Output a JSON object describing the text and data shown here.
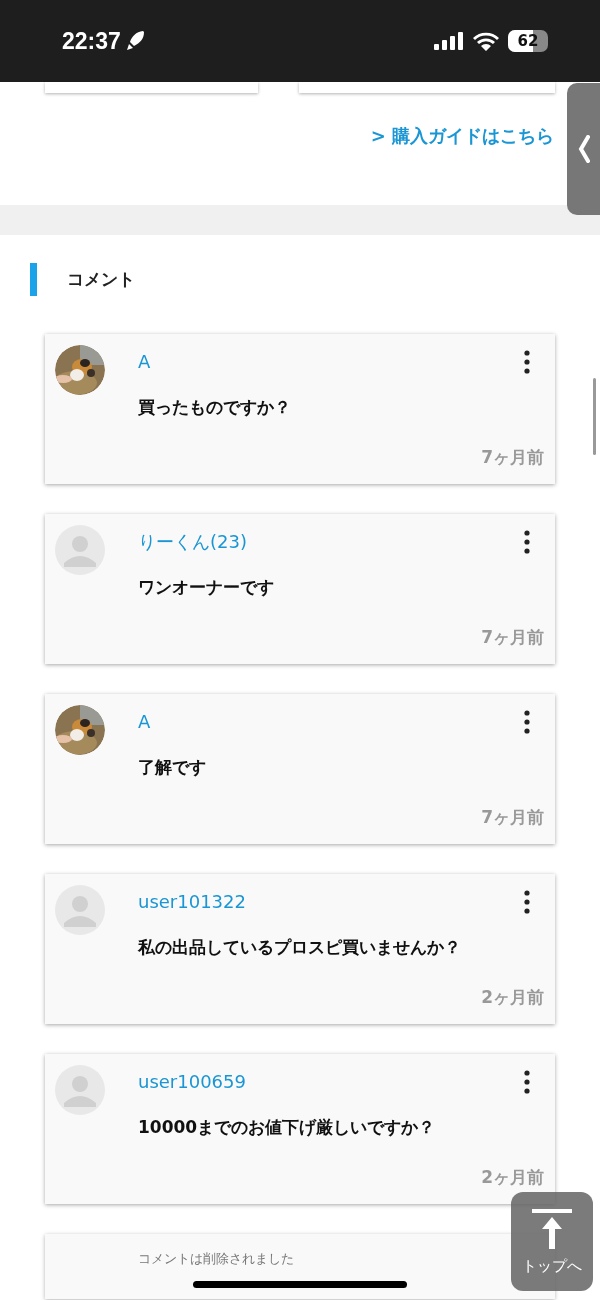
{
  "status_bar": {
    "time": "22:37",
    "battery": "62"
  },
  "guide_link": "> 購入ガイドはこちら",
  "comments_section": {
    "title": "コメント",
    "comments": [
      {
        "kind": "comment",
        "user": "A",
        "text": "買ったものですか？",
        "time": "7ヶ月前"
      },
      {
        "kind": "comment",
        "avatar": {
          "kind": "default"
        },
        "user": "りーくん(23)",
        "text": "ワンオーナーです",
        "time": "7ヶ月前"
      },
      {
        "kind": "comment",
        "user": "A",
        "text": "了解です",
        "time": "7ヶ月前"
      },
      {
        "kind": "comment",
        "avatar": {
          "kind": "default"
        },
        "user": "user101322",
        "text": "私の出品しているプロスピ買いませんか？",
        "time": "2ヶ月前"
      },
      {
        "kind": "comment",
        "avatar": {
          "kind": "default"
        },
        "user": "user100659",
        "text": "10000までのお値下げ厳しいですか？",
        "time": "2ヶ月前"
      },
      {
        "kind": "deleted",
        "text": "コメントは削除されました"
      }
    ]
  },
  "back_to_top": {
    "label": "トップへ"
  }
}
